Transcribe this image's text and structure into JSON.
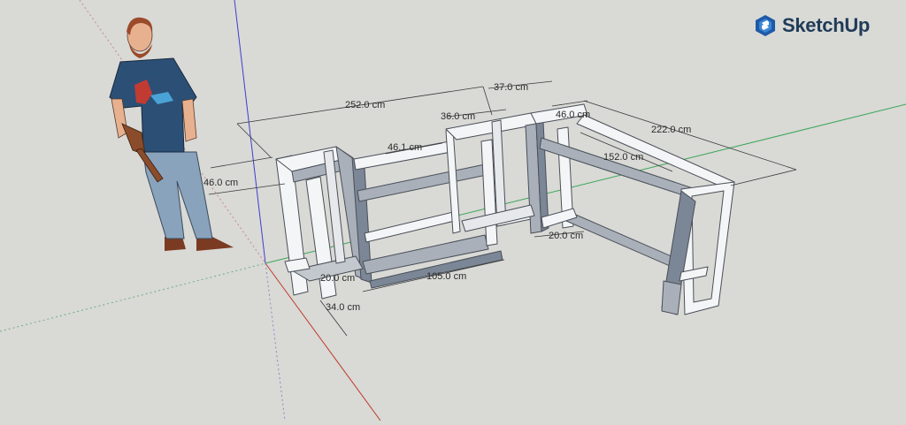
{
  "app": {
    "brand_name": "SketchUp",
    "brand_color": "#1f5aa6"
  },
  "icons": {
    "brand": "sketchup-logo-icon"
  },
  "colors": {
    "background": "#d9d9d6",
    "frame_light": "#f4f5f7",
    "frame_shade": "#a9b0ba",
    "frame_dark": "#7b8796",
    "axis_red": "#c0392b",
    "axis_green": "#3aa655",
    "axis_blue": "#3d3dcc"
  },
  "dimensions": {
    "total_width": "252.0 cm",
    "depth_top": "37.0 cm",
    "depth_mid": "36.0 cm",
    "depth_right": "46.0 cm",
    "right_length": "222.0 cm",
    "inner_span": "46.1 cm",
    "right_inner": "152.0 cm",
    "left_depth": "46.0 cm",
    "bottom_span": "105.0 cm",
    "bottom_small": "20.0 cm",
    "bottom_depth": "34.0 cm",
    "right_small": "20.0 cm"
  }
}
